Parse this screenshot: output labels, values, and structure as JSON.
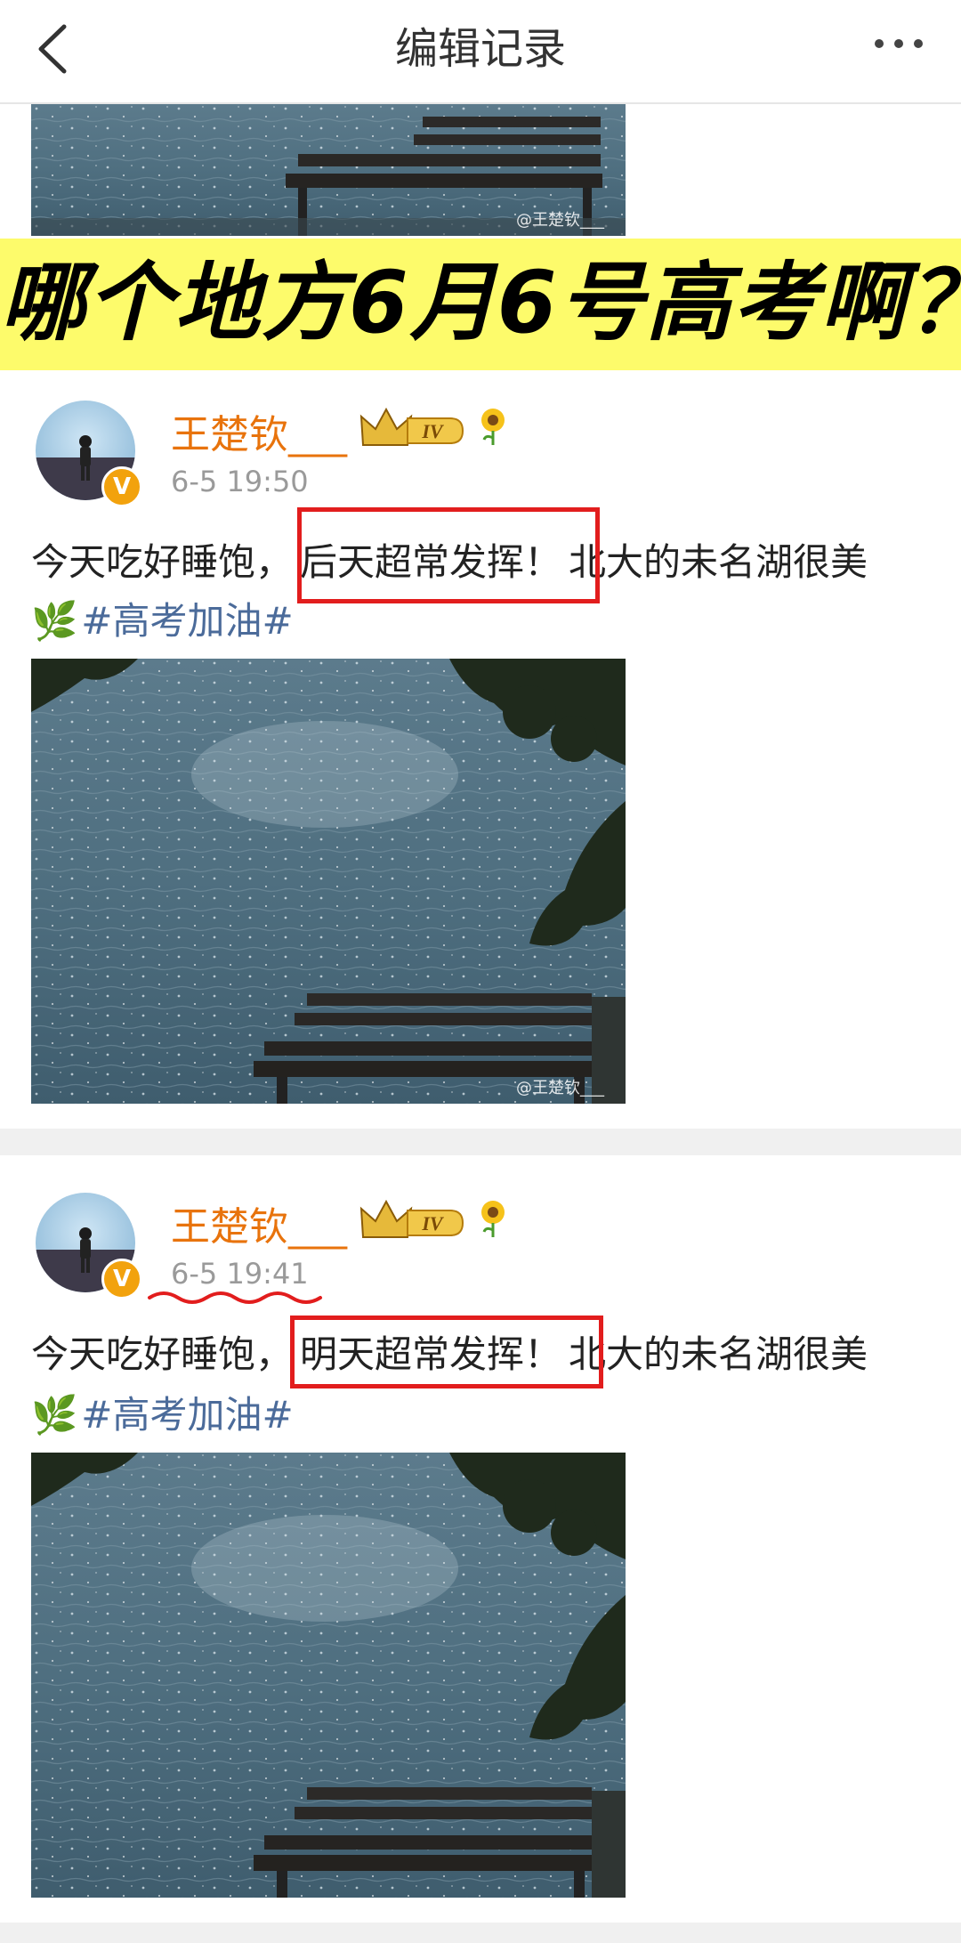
{
  "header": {
    "title": "编辑记录"
  },
  "banner": {
    "text": "哪个地方6月6号高考啊？"
  },
  "watermark": "@王楚钦___",
  "posts": [
    {
      "username": "王楚钦___",
      "level": "IV",
      "time": "6-5 19:50",
      "text_before": "今天吃好睡饱，",
      "text_highlight": "后天超常发挥！",
      "text_after": "北大的未名湖很美",
      "hashtag": "#高考加油#"
    },
    {
      "username": "王楚钦___",
      "level": "IV",
      "time": "6-5 19:41",
      "text_before": "今天吃好睡饱，",
      "text_highlight": "明天超常发挥！",
      "text_after": "北大的未名湖很美",
      "hashtag": "#高考加油#"
    }
  ],
  "colors": {
    "banner_bg": "#fdfb6b",
    "username": "#e8730c",
    "hashtag": "#4b6b9a",
    "highlight_box": "#e21d1d",
    "verified_badge": "#f2a20d"
  },
  "icons": [
    "back-chevron-icon",
    "more-dots-icon",
    "crown-icon",
    "sunflower-icon",
    "leaf-icon",
    "verified-icon"
  ]
}
